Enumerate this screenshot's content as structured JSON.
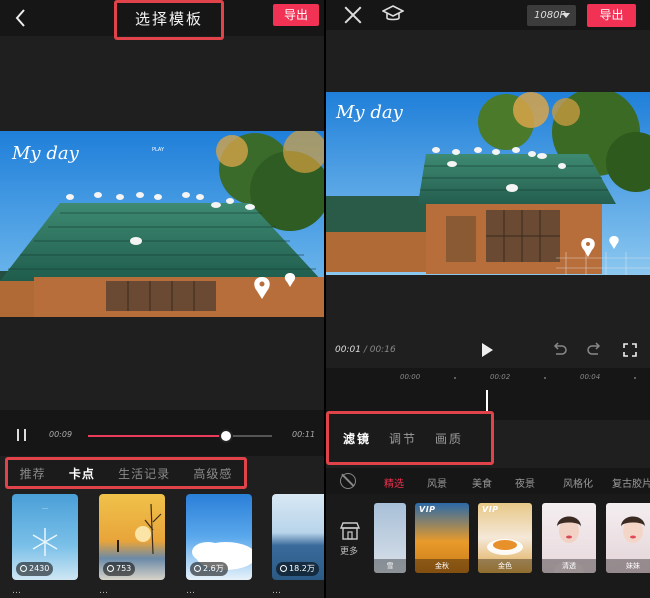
{
  "left": {
    "title": "选择模板",
    "export_label": "导出",
    "video_overlay": {
      "handwriting": "My day",
      "sub": "PLAY"
    },
    "timeline": {
      "current": "00:09",
      "duration": "00:11",
      "progress": 0.75
    },
    "categories": [
      {
        "label": "推荐",
        "active": false
      },
      {
        "label": "卡点",
        "active": true
      },
      {
        "label": "生活记录",
        "active": false
      },
      {
        "label": "高级感",
        "active": false
      }
    ],
    "templates": [
      {
        "count": "2430",
        "caption": "…",
        "thumb_text": "…"
      },
      {
        "count": "753",
        "caption": "…"
      },
      {
        "count": "2.6万",
        "caption": "…"
      },
      {
        "count": "18.2万",
        "caption": "…"
      }
    ]
  },
  "right": {
    "resolution": "1080P",
    "export_label": "导出",
    "video_overlay": {
      "handwriting": "My day"
    },
    "time_current": "00:01",
    "time_separator": "/",
    "time_total": "00:16",
    "ruler": [
      "00:00",
      "00:02",
      "00:04"
    ],
    "tabs": [
      {
        "label": "滤镜",
        "active": true
      },
      {
        "label": "调节",
        "active": false
      },
      {
        "label": "画质",
        "active": false
      }
    ],
    "filter_categories": [
      {
        "label": "精选",
        "active": true
      },
      {
        "label": "风景",
        "active": false
      },
      {
        "label": "美食",
        "active": false
      },
      {
        "label": "夜景",
        "active": false
      },
      {
        "label": "风格化",
        "active": false
      },
      {
        "label": "复古胶片",
        "active": false
      }
    ],
    "more_label": "更多",
    "filters": [
      {
        "label": "雪",
        "vip": false
      },
      {
        "label": "金秋",
        "vip": true,
        "vip_label": "VIP"
      },
      {
        "label": "金色",
        "vip": true,
        "vip_label": "VIP"
      },
      {
        "label": "清透",
        "vip": false
      },
      {
        "label": "妹妹",
        "vip": false
      }
    ]
  },
  "colors": {
    "accent": "#f23255",
    "highlight_box": "#e0444a",
    "panel_bg": "#1f1f1f"
  }
}
